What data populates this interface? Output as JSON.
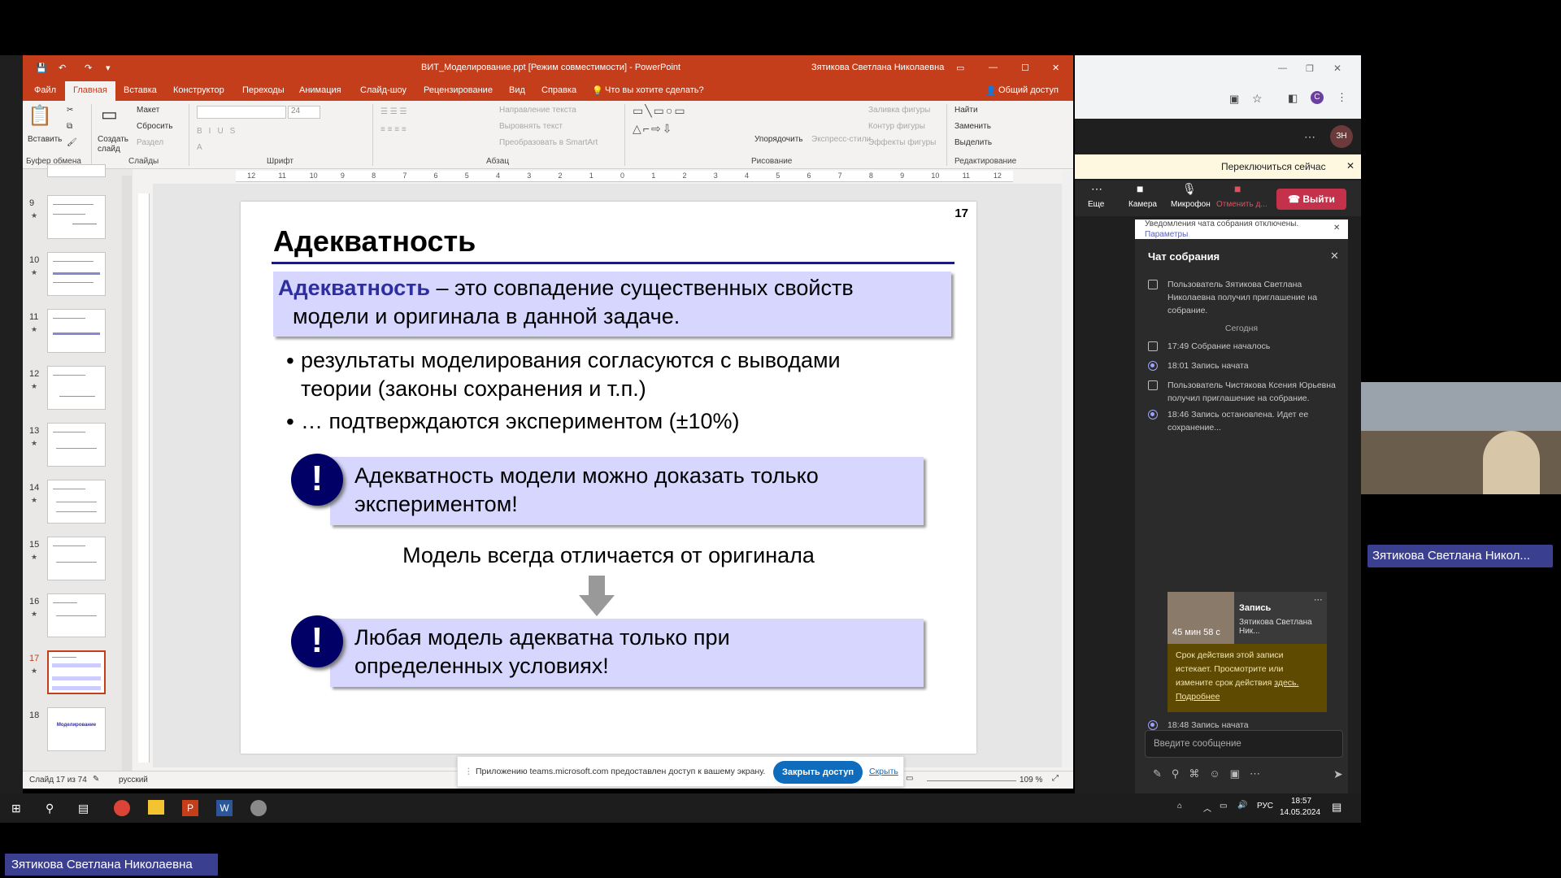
{
  "ppt": {
    "title": "ВИТ_Моделирование.ppt [Режим совместимости] - PowerPoint",
    "user": "Зятикова Светлана Николаевна",
    "tabs": [
      "Файл",
      "Главная",
      "Вставка",
      "Конструктор",
      "Переходы",
      "Анимация",
      "Слайд-шоу",
      "Рецензирование",
      "Вид",
      "Справка"
    ],
    "tell_me": "Что вы хотите сделать?",
    "share": "Общий доступ",
    "ribbon": {
      "paste": "Вставить",
      "clipboard_group": "Буфер обмена",
      "new_slide": "Создать слайд",
      "layout": "Макет",
      "reset": "Сбросить",
      "section": "Раздел",
      "slides_group": "Слайды",
      "font_group": "Шрифт",
      "font_size": "24",
      "paragraph_group": "Абзац",
      "text_direction": "Направление текста",
      "align_text": "Выровнять текст",
      "smartart": "Преобразовать в SmartArt",
      "arrange": "Упорядочить",
      "quick_styles": "Экспресс-стили",
      "shape_fill": "Заливка фигуры",
      "shape_outline": "Контур фигуры",
      "shape_effects": "Эффекты фигуры",
      "drawing_group": "Рисование",
      "find": "Найти",
      "replace": "Заменить",
      "select": "Выделить",
      "editing_group": "Редактирование"
    },
    "thumb_numbers": [
      "9",
      "10",
      "11",
      "12",
      "13",
      "14",
      "15",
      "16",
      "17",
      "18"
    ],
    "thumb18_text": "Моделирование",
    "ruler_labels": [
      "12",
      "11",
      "10",
      "9",
      "8",
      "7",
      "6",
      "5",
      "4",
      "3",
      "2",
      "1",
      "0",
      "1",
      "2",
      "3",
      "4",
      "5",
      "6",
      "7",
      "8",
      "9",
      "10",
      "11",
      "12"
    ],
    "status_slide": "Слайд 17 из 74",
    "status_lang": "русский",
    "zoom": "109 %"
  },
  "slide": {
    "number": "17",
    "title": "Адекватность",
    "def_term": "Адекватность",
    "def_rest_1": " – это совпадение существенных свойств",
    "def_rest_2": "модели и оригинала в данной задаче.",
    "bullet1_line1": "результаты моделирования согласуются с выводами",
    "bullet1_line2": "теории (законы сохранения и т.п.)",
    "bullet2": "… подтверждаются экспериментом (±10%)",
    "box1_line1": "Адекватность модели можно доказать только",
    "box1_line2": "экспериментом!",
    "middle": "Модель всегда отличается от оригинала",
    "box2_line1": "Любая модель адекватна только при",
    "box2_line2": "определенных условиях!",
    "excl": "!"
  },
  "sharebar": {
    "text": "Приложению teams.microsoft.com предоставлен доступ к вашему экрану.",
    "close": "Закрыть доступ",
    "hide": "Скрыть"
  },
  "teams": {
    "switch_now": "Переключиться сейчас",
    "more": "Еще",
    "camera": "Камера",
    "mic": "Микрофон",
    "share_label": "Отменить д...",
    "leave": "Выйти",
    "notif_text": "Уведомления чата собрания отключены.",
    "notif_link": "Параметры",
    "chat_title": "Чат собрания",
    "msg1": "Пользователь Зятикова Светлана Николаевна получил приглашение на собрание.",
    "today": "Сегодня",
    "msg2": "17:49   Собрание началось",
    "msg3": "18:01   Запись начата",
    "msg4": "Пользователь Чистякова Ксения Юрьевна получил приглашение на собрание.",
    "msg5": "18:46   Запись остановлена. Идет ее сохранение...",
    "rec_duration": "45 мин 58 с",
    "rec_title": "Запись",
    "rec_owner": "Зятикова Светлана Ник...",
    "warn_text": "Срок действия этой записи истекает. Просмотрите или измените срок действия",
    "warn_link": "здесь.",
    "warn_more": "Подробнее",
    "msg6": "18:48   Запись начата",
    "input_placeholder": "Введите сообщение",
    "avatar": "ЗН"
  },
  "participant_name": "Зятикова Светлана Никол...",
  "taskbar": {
    "lang": "РУС",
    "time": "18:57",
    "date": "14.05.2024"
  },
  "bottom_name": "Зятикова Светлана Николаевна"
}
